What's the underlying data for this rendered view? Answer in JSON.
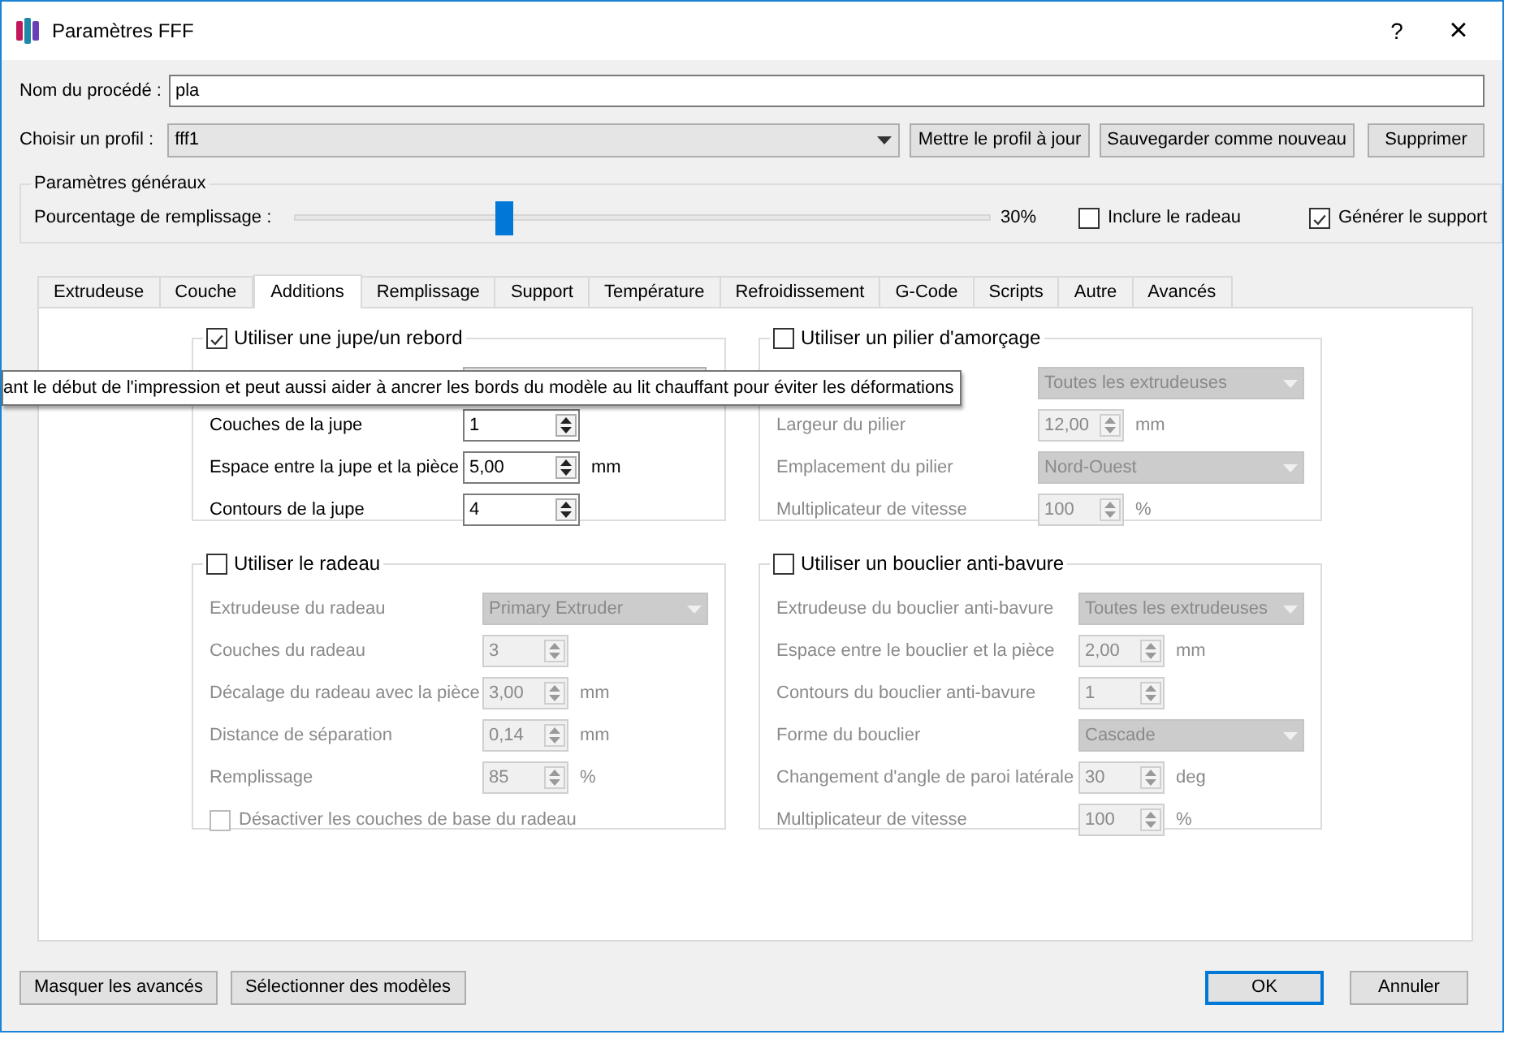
{
  "window": {
    "title": "Paramètres FFF",
    "help": "?",
    "close": "×"
  },
  "process_name": {
    "label": "Nom du procédé :",
    "value": "pla"
  },
  "profile": {
    "label": "Choisir un profil :",
    "value": "fff1",
    "buttons": [
      "Mettre le profil à jour",
      "Sauvegarder comme nouveau",
      "Supprimer"
    ]
  },
  "general": {
    "title": "Paramètres généraux",
    "fill": {
      "label": "Pourcentage de remplissage :",
      "level": 0.3,
      "reading": "30%"
    },
    "checkboxes": [
      {
        "label": "Inclure le radeau",
        "checked": false
      },
      {
        "label": "Générer le support",
        "checked": true
      }
    ]
  },
  "tabs": [
    {
      "label": "Extrudeuse",
      "selected": false
    },
    {
      "label": "Couche",
      "selected": false
    },
    {
      "label": "Additions",
      "selected": true
    },
    {
      "label": "Remplissage",
      "selected": false
    },
    {
      "label": "Support",
      "selected": false
    },
    {
      "label": "Température",
      "selected": false
    },
    {
      "label": "Refroidissement",
      "selected": false
    },
    {
      "label": "G-Code",
      "selected": false
    },
    {
      "label": "Scripts",
      "selected": false
    },
    {
      "label": "Autre",
      "selected": false
    },
    {
      "label": "Avancés",
      "selected": false
    }
  ],
  "groups": [
    {
      "title": "Utiliser une jupe/un rebord",
      "checked": true,
      "rows": [
        {
          "kind": "combo"
        },
        {
          "kind": "spin",
          "label": "Couches de la jupe",
          "value": "1"
        },
        {
          "kind": "spin",
          "label": "Espace entre la jupe et la pièce",
          "value": "5,00",
          "unit": "mm"
        },
        {
          "kind": "spin",
          "label": "Contours de la jupe",
          "value": "4"
        }
      ]
    },
    {
      "title": "Utiliser un pilier d'amorçage",
      "checked": false,
      "rows": [
        {
          "kind": "combo",
          "value": "Toutes les extrudeuses"
        },
        {
          "kind": "spin",
          "label": "Largeur du pilier",
          "value": "12,00",
          "unit": "mm"
        },
        {
          "kind": "combo",
          "label": "Emplacement du pilier",
          "value": "Nord-Ouest"
        },
        {
          "kind": "spin",
          "label": "Multiplicateur de vitesse",
          "value": "100",
          "unit": "%"
        }
      ]
    },
    {
      "title": "Utiliser le radeau",
      "checked": false,
      "rows": [
        {
          "kind": "combo",
          "label": "Extrudeuse du radeau",
          "value": "Primary Extruder"
        },
        {
          "kind": "spin",
          "label": "Couches du radeau",
          "value": "3"
        },
        {
          "kind": "spin",
          "label": "Décalage du radeau avec la pièce",
          "value": "3,00",
          "unit": "mm"
        },
        {
          "kind": "spin",
          "label": "Distance de séparation",
          "value": "0,14",
          "unit": "mm"
        },
        {
          "kind": "spin",
          "label": "Remplissage",
          "value": "85",
          "unit": "%"
        },
        {
          "kind": "checkbox",
          "label": "Désactiver les couches de base du radeau",
          "checked": false
        }
      ]
    },
    {
      "title": "Utiliser un bouclier anti-bavure",
      "checked": false,
      "rows": [
        {
          "kind": "combo",
          "label": "Extrudeuse du bouclier anti-bavure",
          "value": "Toutes les extrudeuses"
        },
        {
          "kind": "spin",
          "label": "Espace entre le bouclier et la pièce",
          "value": "2,00",
          "unit": "mm"
        },
        {
          "kind": "spin",
          "label": "Contours du bouclier anti-bavure",
          "value": "1"
        },
        {
          "kind": "combo",
          "label": "Forme du bouclier",
          "value": "Cascade"
        },
        {
          "kind": "spin",
          "label": "Changement d'angle de paroi latérale",
          "value": "30",
          "unit": "deg"
        },
        {
          "kind": "spin",
          "label": "Multiplicateur de vitesse",
          "value": "100",
          "unit": "%"
        }
      ]
    }
  ],
  "tooltip": {
    "text": "ant le début de l'impression et peut aussi aider à ancrer les bords du modèle au lit chauffant pour éviter les déformations"
  },
  "footer": {
    "left_buttons": [
      "Masquer les avancés",
      "Sélectionner des modèles"
    ],
    "right_buttons": [
      {
        "label": "OK",
        "default": true
      },
      {
        "label": "Annuler",
        "default": false
      }
    ]
  }
}
